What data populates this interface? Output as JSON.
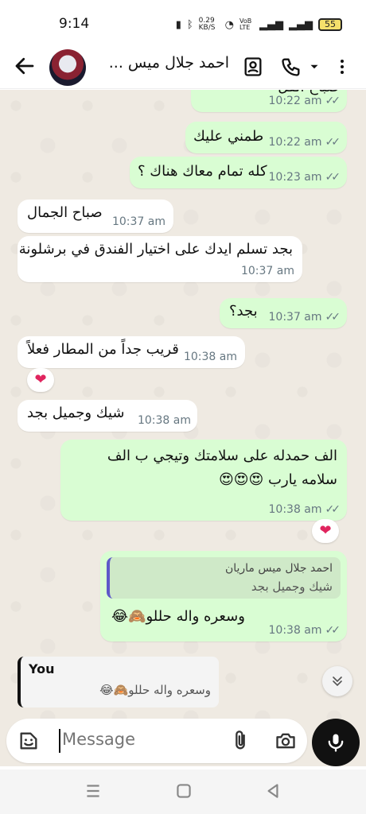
{
  "status": {
    "time": "9:14",
    "net_speed": "0.29 KB/S",
    "volte": "VoB LTE",
    "battery": "55"
  },
  "header": {
    "contact_name": "احمد جلال ميس ..."
  },
  "messages": [
    {
      "text": "صباح الفل",
      "time": "10:22 am"
    },
    {
      "text": "طمني عليك",
      "time": "10:22 am"
    },
    {
      "text": "كله تمام معاك هناك ؟",
      "time": "10:23 am"
    },
    {
      "text": "صباح الجمال",
      "time": "10:37 am"
    },
    {
      "text": "بجد تسلم ايدك على اختيار الفندق في برشلونة",
      "time": "10:37 am"
    },
    {
      "text": "بجد؟",
      "time": "10:37 am"
    },
    {
      "text": "قريب جداً من المطار فعلاً",
      "time": "10:38 am",
      "reaction": "❤"
    },
    {
      "text": "شيك وجميل بجد",
      "time": "10:38 am"
    },
    {
      "text": "الف حمدله على سلامتك وتيجي ب الف سلامه يارب 😍😍😍",
      "time": "10:38 am",
      "reaction": "❤"
    },
    {
      "quote_name": "احمد جلال  ميس ماريان",
      "quote_text": "شيك وجميل بجد",
      "text": "وسعره واله حللو🙈😂",
      "time": "10:38 am"
    }
  ],
  "reply_preview": {
    "name": "You",
    "text": "وسعره واله حللو🙈😂"
  },
  "composer": {
    "placeholder": "Message"
  },
  "colors": {
    "out_bubble": "#d9fdd3",
    "in_bubble": "#ffffff",
    "chat_bg": "#efeae2"
  }
}
